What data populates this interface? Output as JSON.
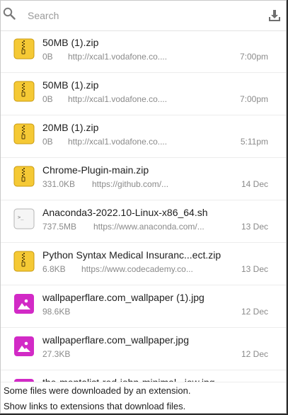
{
  "search": {
    "placeholder": "Search"
  },
  "icons": {
    "search": "search-icon",
    "downloads": "download-icon",
    "zip": "zip-archive-icon",
    "script": "terminal-script-icon",
    "image": "image-icon"
  },
  "colors": {
    "zip_bg": "#f5c935",
    "image_bg": "#d22ac6",
    "text": "#202020",
    "muted": "#8a8a8a"
  },
  "downloads": [
    {
      "name": "50MB (1).zip",
      "size": "0B",
      "url": "http://xcal1.vodafone.co....",
      "time": "7:00pm",
      "type": "zip"
    },
    {
      "name": "50MB (1).zip",
      "size": "0B",
      "url": "http://xcal1.vodafone.co....",
      "time": "7:00pm",
      "type": "zip"
    },
    {
      "name": "20MB (1).zip",
      "size": "0B",
      "url": "http://xcal1.vodafone.co....",
      "time": "5:11pm",
      "type": "zip"
    },
    {
      "name": "Chrome-Plugin-main.zip",
      "size": "331.0KB",
      "url": "https://github.com/...",
      "time": "14 Dec",
      "type": "zip"
    },
    {
      "name": "Anaconda3-2022.10-Linux-x86_64.sh",
      "size": "737.5MB",
      "url": "https://www.anaconda.com/...",
      "time": "13 Dec",
      "type": "script"
    },
    {
      "name": "Python Syntax Medical Insuranc...ect.zip",
      "size": "6.8KB",
      "url": "https://www.codecademy.co...",
      "time": "13 Dec",
      "type": "zip"
    },
    {
      "name": "wallpaperflare.com_wallpaper (1).jpg",
      "size": "98.6KB",
      "url": "",
      "time": "12 Dec",
      "type": "image"
    },
    {
      "name": "wallpaperflare.com_wallpaper.jpg",
      "size": "27.3KB",
      "url": "",
      "time": "12 Dec",
      "type": "image"
    },
    {
      "name": "the-mentalist-red-john-minimal...iew.jpg",
      "size": "",
      "url": "",
      "time": "",
      "type": "image"
    }
  ],
  "footer": {
    "notice": "Some files were downloaded by an extension.",
    "link": "Show links to extensions that download files."
  }
}
